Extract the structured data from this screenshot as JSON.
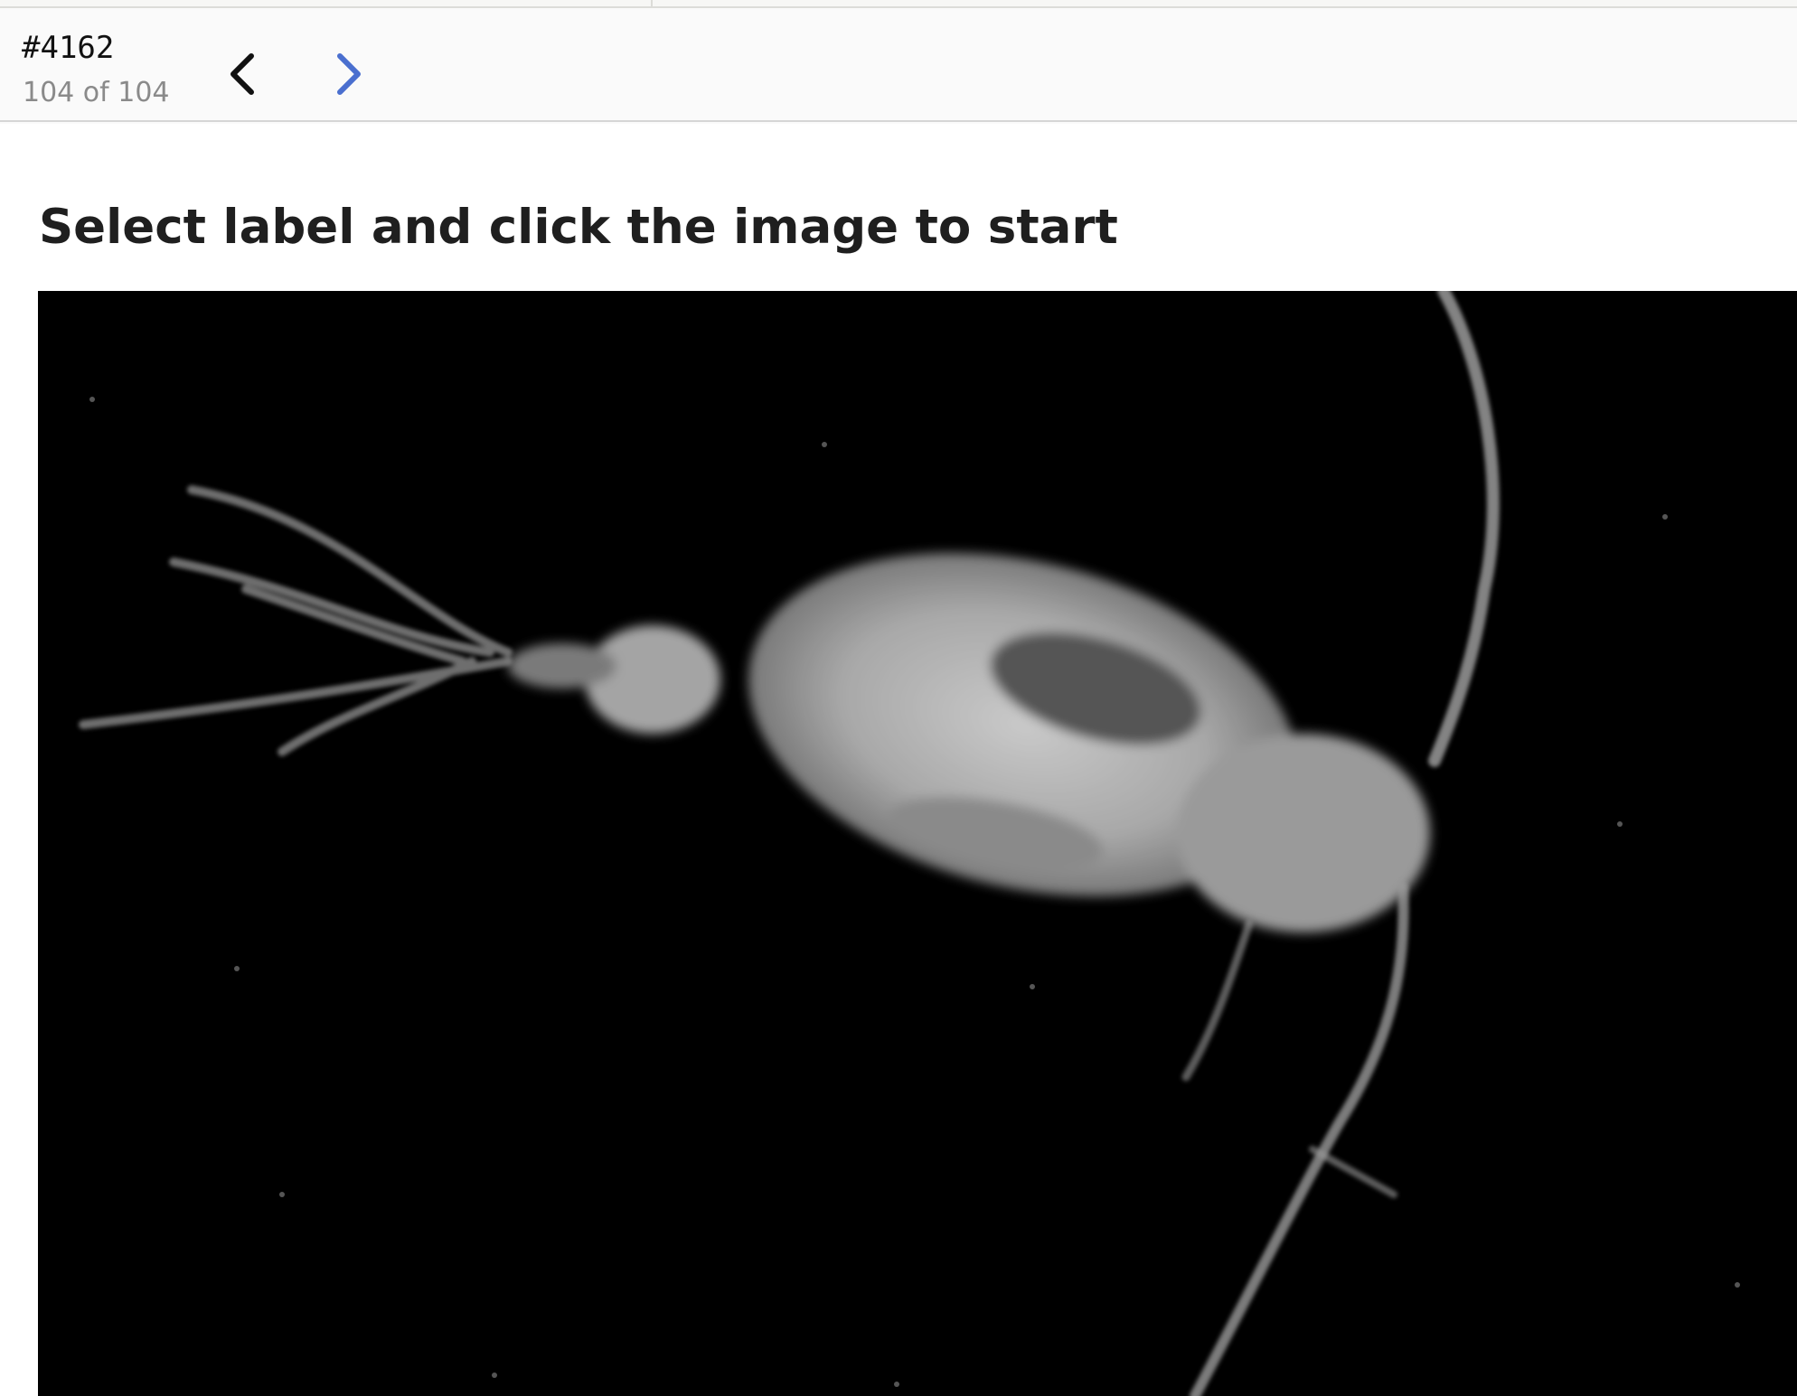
{
  "task": {
    "id": "#4162",
    "counter": "104 of 104"
  },
  "navigation": {
    "prev_icon": "chevron-left-icon",
    "next_icon": "chevron-right-icon",
    "prev_color": "#111111",
    "next_color": "#4a6fcf"
  },
  "instruction": {
    "text": "Select label and click the image to start"
  },
  "image": {
    "subject": "grayscale microscopy image of a plankton organism on black background",
    "background_color": "#000000"
  }
}
